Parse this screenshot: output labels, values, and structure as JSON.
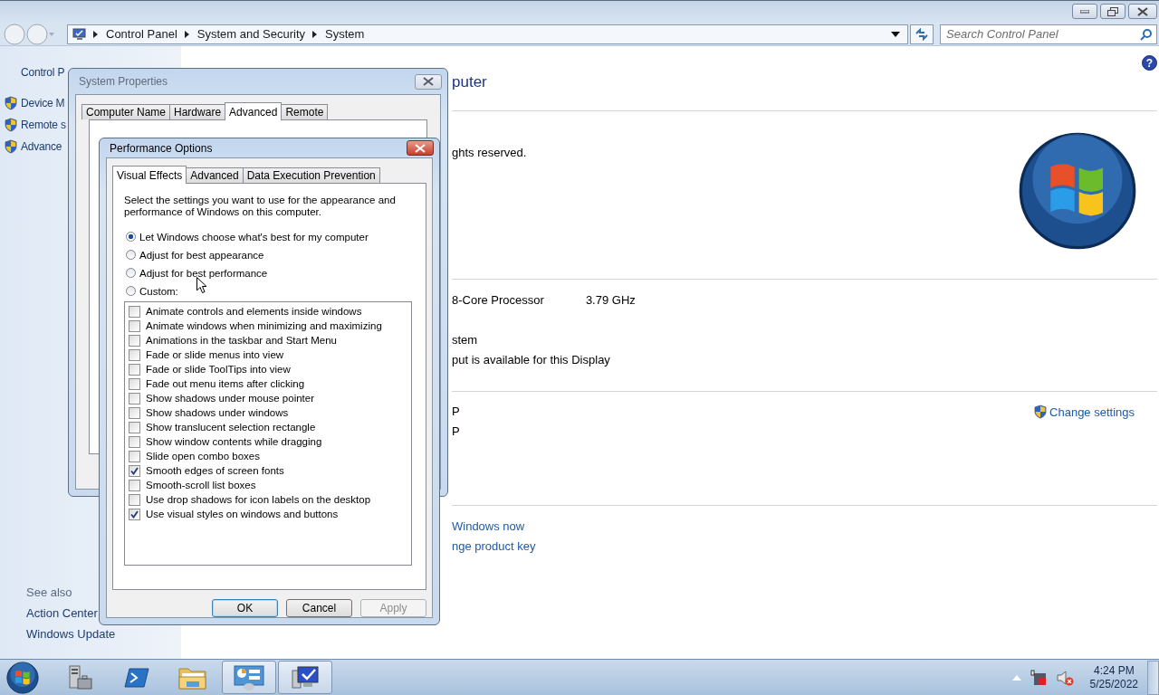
{
  "address_bar": {
    "breadcrumb": [
      "Control Panel",
      "System and Security",
      "System"
    ],
    "search": {
      "placeholder": "Search Control Panel"
    }
  },
  "sidebar": {
    "items": [
      {
        "label": "Control P",
        "shield": false
      },
      {
        "label": "Device M",
        "shield": true
      },
      {
        "label": "Remote s",
        "shield": true
      },
      {
        "label": "Advance",
        "shield": true
      }
    ],
    "see_also": {
      "heading": "See also",
      "items": [
        "Action Center",
        "Windows Update"
      ]
    }
  },
  "content": {
    "help_icon": "?",
    "heading": "puter",
    "sections": [
      {
        "rows": [
          {
            "kind": "text",
            "text": "ghts reserved."
          }
        ]
      },
      {
        "rows": [
          {
            "kind": "text",
            "text": "8-Core Processor",
            "value": "3.79 GHz"
          },
          {
            "kind": "gap"
          },
          {
            "kind": "text",
            "text": "stem"
          },
          {
            "kind": "text",
            "text": "put is available for this Display"
          }
        ]
      },
      {
        "rows": [
          {
            "kind": "text",
            "text": "P"
          },
          {
            "kind": "text",
            "text": "P"
          }
        ],
        "action": "Change settings"
      },
      {
        "rows": [
          {
            "kind": "link",
            "text": "Windows now"
          },
          {
            "kind": "link",
            "text": "nge product key"
          }
        ]
      }
    ]
  },
  "system_properties": {
    "title": "System Properties",
    "tabs": [
      {
        "label": "Computer Name",
        "selected": false
      },
      {
        "label": "Hardware",
        "selected": false
      },
      {
        "label": "Advanced",
        "selected": true
      },
      {
        "label": "Remote",
        "selected": false
      }
    ]
  },
  "performance_options": {
    "title": "Performance Options",
    "tabs": [
      {
        "label": "Visual Effects",
        "selected": true
      },
      {
        "label": "Advanced",
        "selected": false
      },
      {
        "label": "Data Execution Prevention",
        "selected": false
      }
    ],
    "description": "Select the settings you want to use for the appearance and performance of Windows on this computer.",
    "radios": [
      {
        "label": "Let Windows choose what's best for my computer",
        "selected": true
      },
      {
        "label": "Adjust for best appearance",
        "selected": false
      },
      {
        "label": "Adjust for best performance",
        "selected": false
      },
      {
        "label": "Custom:",
        "selected": false
      }
    ],
    "effects": [
      {
        "label": "Animate controls and elements inside windows",
        "checked": false
      },
      {
        "label": "Animate windows when minimizing and maximizing",
        "checked": false
      },
      {
        "label": "Animations in the taskbar and Start Menu",
        "checked": false
      },
      {
        "label": "Fade or slide menus into view",
        "checked": false
      },
      {
        "label": "Fade or slide ToolTips into view",
        "checked": false
      },
      {
        "label": "Fade out menu items after clicking",
        "checked": false
      },
      {
        "label": "Show shadows under mouse pointer",
        "checked": false
      },
      {
        "label": "Show shadows under windows",
        "checked": false
      },
      {
        "label": "Show translucent selection rectangle",
        "checked": false
      },
      {
        "label": "Show window contents while dragging",
        "checked": false
      },
      {
        "label": "Slide open combo boxes",
        "checked": false
      },
      {
        "label": "Smooth edges of screen fonts",
        "checked": true
      },
      {
        "label": "Smooth-scroll list boxes",
        "checked": false
      },
      {
        "label": "Use drop shadows for icon labels on the desktop",
        "checked": false
      },
      {
        "label": "Use visual styles on windows and buttons",
        "checked": true
      }
    ],
    "buttons": [
      {
        "label": "OK",
        "default": true,
        "disabled": false
      },
      {
        "label": "Cancel",
        "default": false,
        "disabled": false
      },
      {
        "label": "Apply",
        "default": false,
        "disabled": true
      }
    ]
  },
  "taskbar": {
    "apps": [
      {
        "kind": "server",
        "active": false
      },
      {
        "kind": "shell",
        "active": false
      },
      {
        "kind": "folder",
        "active": false
      },
      {
        "kind": "panel",
        "active": true
      },
      {
        "kind": "monitor",
        "active": true
      }
    ],
    "clock": {
      "time": "4:24 PM",
      "date": "5/25/2022"
    }
  }
}
